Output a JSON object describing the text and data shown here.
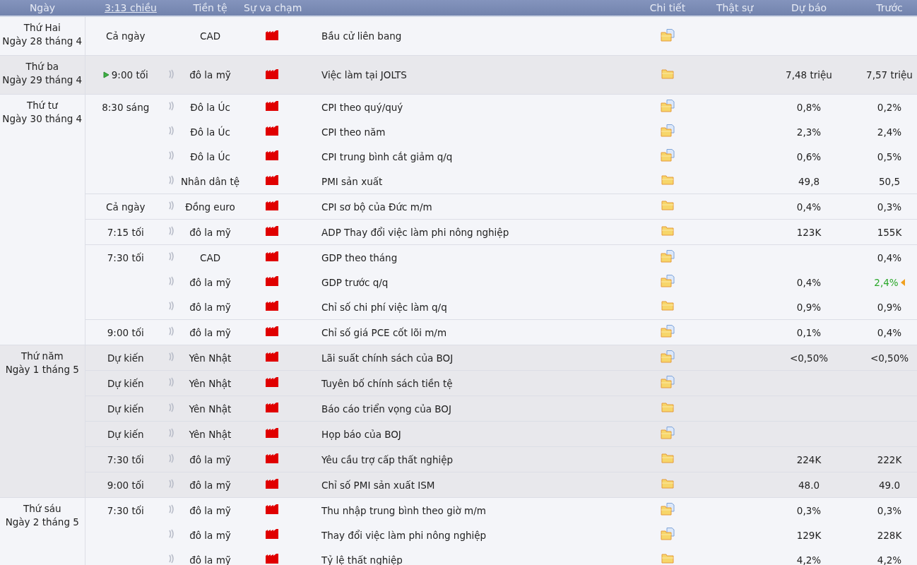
{
  "columns": [
    {
      "label": "Ngày",
      "kind": "text"
    },
    {
      "label": "3:13 chiều",
      "kind": "link"
    },
    {
      "label": "Tiền tệ",
      "kind": "text"
    },
    {
      "label": "Sự va chạm",
      "kind": "text"
    },
    {
      "label": "Chi tiết",
      "kind": "text"
    },
    {
      "label": "Thật sự",
      "kind": "text"
    },
    {
      "label": "Dự báo",
      "kind": "text"
    },
    {
      "label": "Trước",
      "kind": "text"
    }
  ],
  "days": [
    {
      "weekday": "Thứ Hai",
      "date": "Ngày 28 tháng 4",
      "groups": [
        {
          "time": "Cả ngày",
          "events": [
            {
              "sound": false,
              "next": false,
              "currency": "CAD",
              "event": "Bầu cử liên bang",
              "kind": "document",
              "revised": false
            }
          ]
        }
      ]
    },
    {
      "weekday": "Thứ ba",
      "date": "Ngày 29 tháng 4",
      "groups": [
        {
          "time": "9:00 tối",
          "events": [
            {
              "sound": true,
              "next": true,
              "currency": "đô la mỹ",
              "event": "Việc làm tại JOLTS",
              "kind": "folder",
              "forecast": "7,48 triệu",
              "previous": "7,57 triệu",
              "revised": false
            }
          ]
        }
      ]
    },
    {
      "weekday": "Thứ tư",
      "date": "Ngày 30 tháng 4",
      "groups": [
        {
          "time": "8:30 sáng",
          "events": [
            {
              "sound": true,
              "next": false,
              "currency": "Đô la Úc",
              "event": "CPI theo quý/quý",
              "kind": "document",
              "forecast": "0,8%",
              "previous": "0,2%",
              "revised": false
            },
            {
              "sound": true,
              "next": false,
              "currency": "Đô la Úc",
              "event": "CPI theo năm",
              "kind": "document",
              "forecast": "2,3%",
              "previous": "2,4%",
              "revised": false
            },
            {
              "sound": true,
              "next": false,
              "currency": "Đô la Úc",
              "event": "CPI trung bình cắt giảm q/q",
              "kind": "document",
              "forecast": "0,6%",
              "previous": "0,5%",
              "revised": false
            },
            {
              "sound": true,
              "next": false,
              "currency": "Nhân dân tệ",
              "event": "PMI sản xuất",
              "kind": "folder",
              "forecast": "49,8",
              "previous": "50,5",
              "revised": false
            }
          ]
        },
        {
          "time": "Cả ngày",
          "events": [
            {
              "sound": true,
              "next": false,
              "currency": "Đồng euro",
              "event": "CPI sơ bộ của Đức m/m",
              "kind": "folder",
              "forecast": "0,4%",
              "previous": "0,3%",
              "revised": false
            }
          ]
        },
        {
          "time": "7:15 tối",
          "events": [
            {
              "sound": true,
              "next": false,
              "currency": "đô la mỹ",
              "event": "ADP Thay đổi việc làm phi nông nghiệp",
              "kind": "folder",
              "forecast": "123K",
              "previous": "155K",
              "revised": false
            }
          ]
        },
        {
          "time": "7:30 tối",
          "events": [
            {
              "sound": true,
              "next": false,
              "currency": "CAD",
              "event": "GDP theo tháng",
              "kind": "document",
              "previous": "0,4%",
              "revised": false
            },
            {
              "sound": true,
              "next": false,
              "currency": "đô la mỹ",
              "event": "GDP trước q/q",
              "kind": "document",
              "forecast": "0,4%",
              "previous": "2,4%",
              "revised": true
            },
            {
              "sound": true,
              "next": false,
              "currency": "đô la mỹ",
              "event": "Chỉ số chi phí việc làm q/q",
              "kind": "folder",
              "forecast": "0,9%",
              "previous": "0,9%",
              "revised": false
            }
          ]
        },
        {
          "time": "9:00 tối",
          "events": [
            {
              "sound": true,
              "next": false,
              "currency": "đô la mỹ",
              "event": "Chỉ số giá PCE cốt lõi m/m",
              "kind": "document",
              "forecast": "0,1%",
              "previous": "0,4%",
              "revised": false
            }
          ]
        }
      ]
    },
    {
      "weekday": "Thứ năm",
      "date": "Ngày 1 tháng 5",
      "groups": [
        {
          "time": "Dự kiến",
          "events": [
            {
              "sound": true,
              "next": false,
              "currency": "Yên Nhật",
              "event": "Lãi suất chính sách của BOJ",
              "kind": "document",
              "forecast": "<0,50%",
              "previous": "<0,50%",
              "revised": false
            }
          ]
        },
        {
          "time": "Dự kiến",
          "events": [
            {
              "sound": true,
              "next": false,
              "currency": "Yên Nhật",
              "event": "Tuyên bố chính sách tiền tệ",
              "kind": "document",
              "revised": false
            }
          ]
        },
        {
          "time": "Dự kiến",
          "events": [
            {
              "sound": true,
              "next": false,
              "currency": "Yên Nhật",
              "event": "Báo cáo triển vọng của BOJ",
              "kind": "folder",
              "revised": false
            }
          ]
        },
        {
          "time": "Dự kiến",
          "events": [
            {
              "sound": true,
              "next": false,
              "currency": "Yên Nhật",
              "event": "Họp báo của BOJ",
              "kind": "document",
              "revised": false
            }
          ]
        },
        {
          "time": "7:30 tối",
          "events": [
            {
              "sound": true,
              "next": false,
              "currency": "đô la mỹ",
              "event": "Yêu cầu trợ cấp thất nghiệp",
              "kind": "folder",
              "forecast": "224K",
              "previous": "222K",
              "revised": false
            }
          ]
        },
        {
          "time": "9:00 tối",
          "events": [
            {
              "sound": true,
              "next": false,
              "currency": "đô la mỹ",
              "event": "Chỉ số PMI sản xuất ISM",
              "kind": "folder",
              "forecast": "48.0",
              "previous": "49.0",
              "revised": false
            }
          ]
        }
      ]
    },
    {
      "weekday": "Thứ sáu",
      "date": "Ngày 2 tháng 5",
      "groups": [
        {
          "time": "7:30 tối",
          "events": [
            {
              "sound": true,
              "next": false,
              "currency": "đô la mỹ",
              "event": "Thu nhập trung bình theo giờ m/m",
              "kind": "document",
              "forecast": "0,3%",
              "previous": "0,3%",
              "revised": false
            },
            {
              "sound": true,
              "next": false,
              "currency": "đô la mỹ",
              "event": "Thay đổi việc làm phi nông nghiệp",
              "kind": "document",
              "forecast": "129K",
              "previous": "228K",
              "revised": false
            },
            {
              "sound": true,
              "next": false,
              "currency": "đô la mỹ",
              "event": "Tỷ lệ thất nghiệp",
              "kind": "folder",
              "forecast": "4,2%",
              "previous": "4,2%",
              "revised": false
            }
          ]
        }
      ]
    }
  ]
}
